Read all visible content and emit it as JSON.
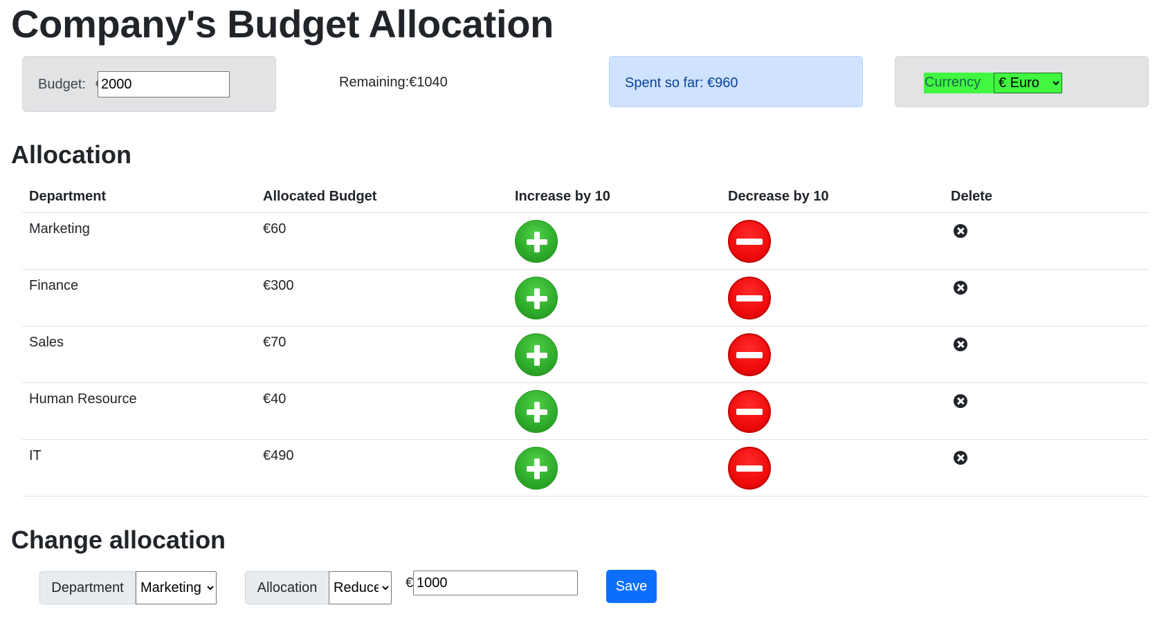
{
  "page": {
    "title": "Company's Budget Allocation"
  },
  "budget": {
    "label": "Budget:",
    "currency_symbol": "€",
    "value": "2000"
  },
  "remaining": {
    "text": "Remaining:€1040"
  },
  "spent": {
    "text": "Spent so far: €960"
  },
  "currency": {
    "label": "Currency",
    "selected": "€ Euro",
    "highlight_color": "#41f740"
  },
  "allocation": {
    "title": "Allocation",
    "headers": [
      "Department",
      "Allocated Budget",
      "Increase by 10",
      "Decrease by 10",
      "Delete"
    ],
    "rows": [
      {
        "department": "Marketing",
        "budget": "€60"
      },
      {
        "department": "Finance",
        "budget": "€300"
      },
      {
        "department": "Sales",
        "budget": "€70"
      },
      {
        "department": "Human Resource",
        "budget": "€40"
      },
      {
        "department": "IT",
        "budget": "€490"
      }
    ],
    "icons": {
      "increase": "plus-circle-icon",
      "decrease": "minus-circle-icon",
      "delete": "x-circle-icon"
    },
    "colors": {
      "increase": "#2eaa2a",
      "decrease": "#ee0a0a"
    }
  },
  "change": {
    "title": "Change allocation",
    "department_label": "Department",
    "department_selected": "Marketing",
    "allocation_label": "Allocation",
    "allocation_selected": "Reduce",
    "currency_symbol": "€",
    "amount": "1000",
    "save_label": "Save",
    "save_color": "#0d6efd"
  }
}
